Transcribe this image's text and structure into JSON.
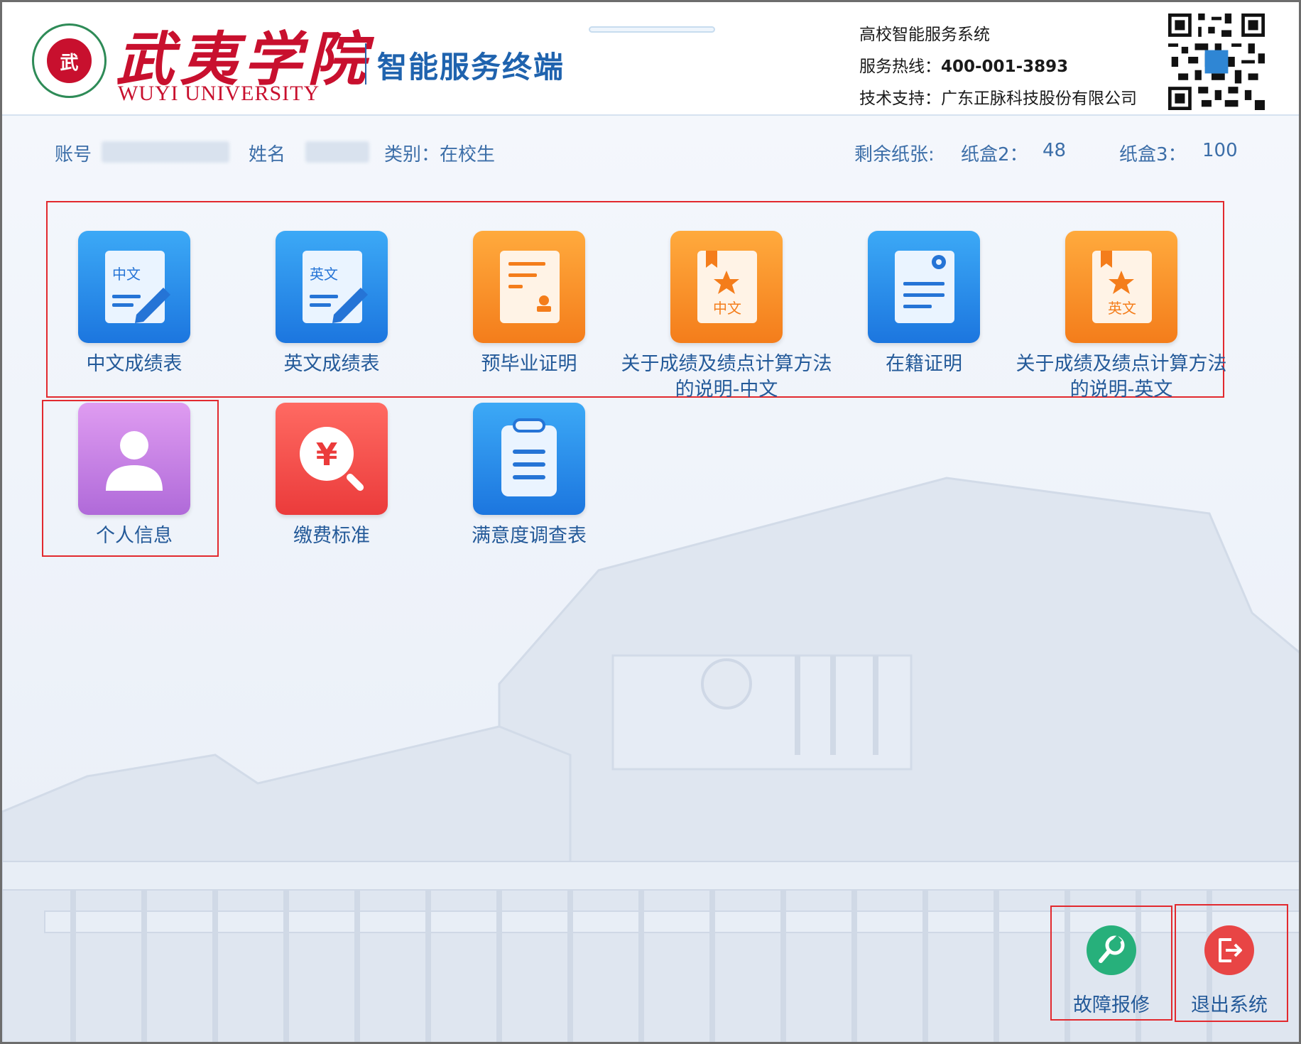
{
  "header": {
    "logo_text_cn": "武夷学院",
    "logo_text_en": "WUYI UNIVERSITY",
    "seal_char": "武",
    "terminal_title": "智能服务终端",
    "system_name": "高校智能服务系统",
    "hotline_label": "服务热线：",
    "hotline_value": "400-001-3893",
    "support_label": "技术支持：",
    "support_value": "广东正脉科技股份有限公司"
  },
  "user": {
    "account_label": "账号",
    "name_label": "姓名",
    "category": "类别：在校生"
  },
  "paper": {
    "remaining_label": "剩余纸张:",
    "box2_label": "纸盒2：",
    "box2_value": "48",
    "box3_label": "纸盒3：",
    "box3_value": "100"
  },
  "tiles": [
    {
      "label": "中文成绩表",
      "icon_text": "中文",
      "color": "blue"
    },
    {
      "label": "英文成绩表",
      "icon_text": "英文",
      "color": "blue"
    },
    {
      "label": "预毕业证明",
      "color": "orange"
    },
    {
      "label": "关于成绩及绩点计算方法的说明-中文",
      "icon_text": "中文",
      "color": "orange"
    },
    {
      "label": "在籍证明",
      "color": "blue"
    },
    {
      "label": "关于成绩及绩点计算方法的说明-英文",
      "icon_text": "英文",
      "color": "orange"
    },
    {
      "label": "个人信息",
      "color": "purple"
    },
    {
      "label": "缴费标准",
      "icon_text": "¥",
      "color": "red"
    },
    {
      "label": "满意度调查表",
      "color": "blue"
    }
  ],
  "actions": {
    "repair_label": "故障报修",
    "exit_label": "退出系统"
  },
  "colors": {
    "accent_blue": "#1f63ae",
    "highlight_red": "#e2292e",
    "repair_green": "#27b07b",
    "exit_red": "#e84545"
  }
}
